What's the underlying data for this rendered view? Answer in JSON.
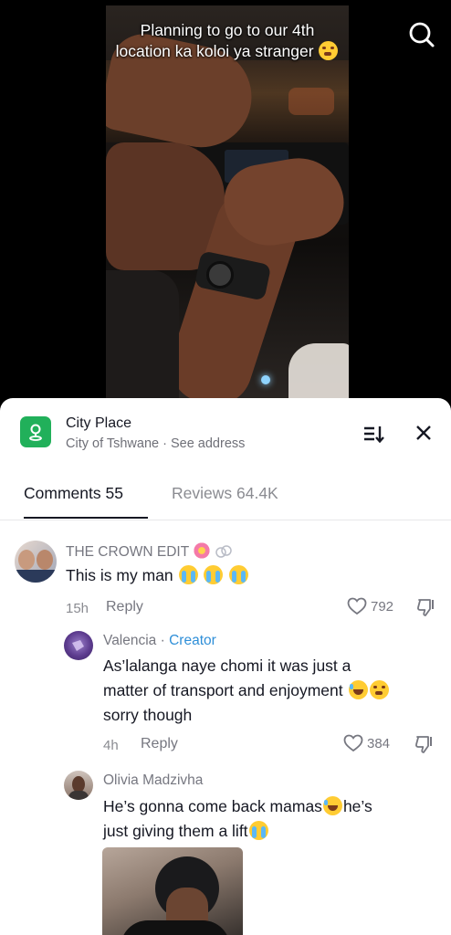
{
  "video": {
    "caption": "Planning to go to our 4th location ka koloi ya stranger"
  },
  "place": {
    "title": "City Place",
    "subtitle": "City of Tshwane · See address"
  },
  "tabs": {
    "comments": "Comments 55",
    "reviews": "Reviews 64.4K"
  },
  "comments": [
    {
      "username": "THE CROWN EDIT",
      "text": "This is my man",
      "time": "15h",
      "reply_label": "Reply",
      "likes": "792"
    },
    {
      "username": "Valencia",
      "badge": "Creator",
      "separator": " · ",
      "text_line1": "As’lalanga naye chomi it was just a",
      "text_line2": "matter of transport and enjoyment",
      "text_line3": "sorry though",
      "time": "4h",
      "reply_label": "Reply",
      "likes": "384"
    },
    {
      "username": "Olivia Madzivha",
      "text_line1a": "He’s gonna come back mamas",
      "text_line1b": "he’s",
      "text_line2": "just giving them a lift"
    }
  ],
  "colors": {
    "accent_green": "#21b05a",
    "creator_blue": "#2f8fd8",
    "text_primary": "#161823",
    "text_secondary": "#767780"
  }
}
